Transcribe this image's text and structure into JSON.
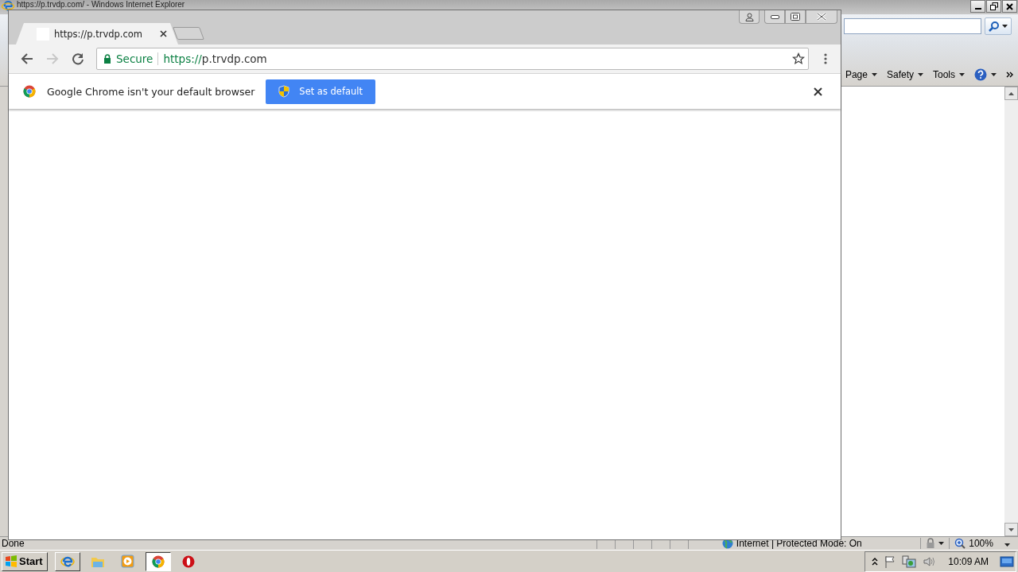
{
  "ie": {
    "title": "https://p.trvdp.com/ - Windows Internet Explorer",
    "commands": [
      {
        "label": "Page"
      },
      {
        "label": "Safety"
      },
      {
        "label": "Tools"
      }
    ],
    "status": "Done",
    "zone": "Internet | Protected Mode: On",
    "zoom": "100%"
  },
  "chrome": {
    "tabs": [
      {
        "title": "https://p.trvdp.com",
        "selected": true
      }
    ],
    "security": "Secure",
    "url": {
      "scheme": "https://",
      "host": "p.trvdp.com"
    },
    "infobar": {
      "message": "Google Chrome isn't your default browser",
      "button": "Set as default"
    }
  },
  "taskbar": {
    "start": "Start",
    "apps": [
      {
        "kind": "ie",
        "selected": false
      },
      {
        "kind": "folder",
        "selected": false
      },
      {
        "kind": "media",
        "selected": false
      },
      {
        "kind": "chrome",
        "selected": true
      },
      {
        "kind": "opera",
        "selected": false
      }
    ],
    "clock": "10:09 AM"
  }
}
